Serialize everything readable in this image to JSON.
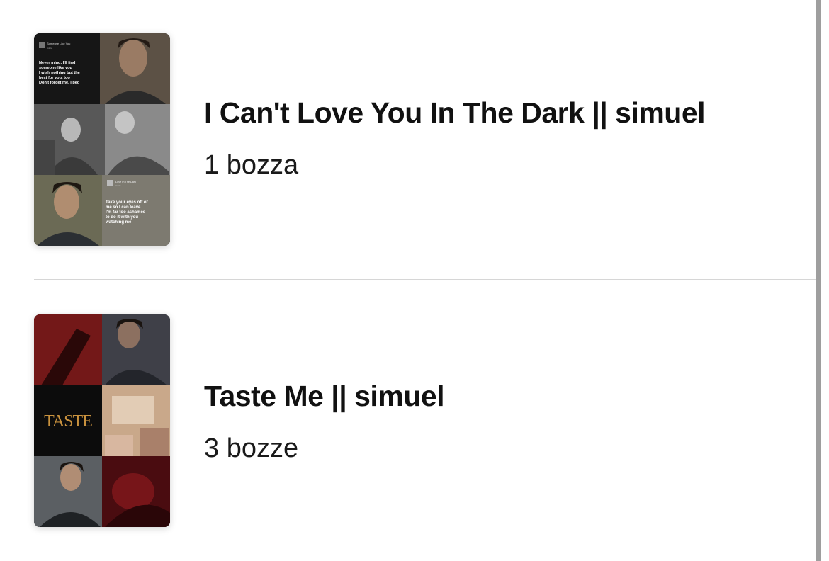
{
  "stories": [
    {
      "title": "I Can't Love You In The Dark || simuel",
      "drafts": "1 bozza",
      "cover": {
        "panel_1": {
          "song": "Someone Like You",
          "artist": "Adele",
          "lyrics": [
            "Never mind, I'll find",
            "someone like you",
            "I wish nothing but the",
            "best for you, too",
            "Don't forget me, I beg"
          ]
        },
        "panel_2": {
          "song": "Love In The Dark",
          "artist": "Adele",
          "lyrics": [
            "Take your eyes off of",
            "me so I can leave",
            "I'm far too ashamed",
            "to do it with you",
            "watching me"
          ]
        }
      }
    },
    {
      "title": "Taste Me || simuel",
      "drafts": "3 bozze",
      "cover": {
        "logo_text": "TASTE"
      }
    }
  ],
  "colors": {
    "title": "#111111",
    "divider": "#d6d6d6",
    "scrollbar": "#9e9e9e",
    "gold": "#c9923e"
  }
}
